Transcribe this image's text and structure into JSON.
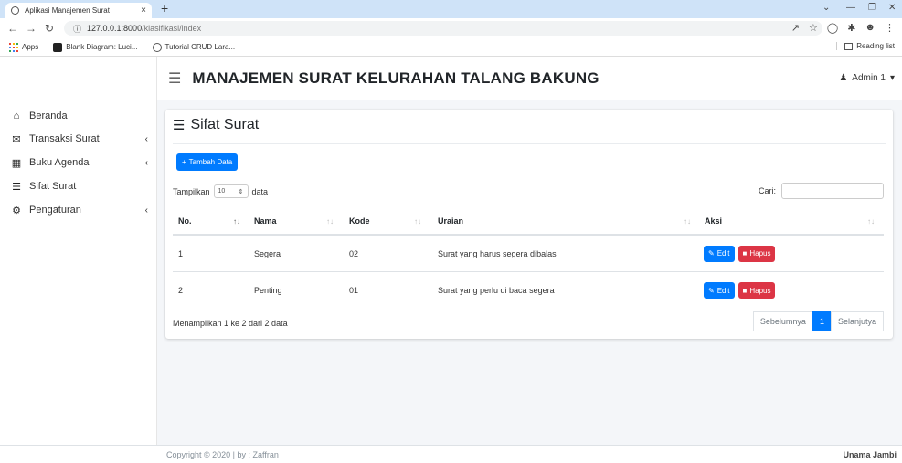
{
  "browser": {
    "tab_title": "Aplikasi Manajemen Surat",
    "tab_close": "×",
    "new_tab": "+",
    "url_host": "127.0.0.1:8000",
    "url_path": "/klasifikasi/index",
    "bookmarks": [
      "Apps",
      "Blank Diagram: Luci...",
      "Tutorial CRUD Lara..."
    ],
    "reading_list": "Reading list"
  },
  "navbar": {
    "title": "MANAJEMEN SURAT KELURAHAN TALANG BAKUNG",
    "user": "Admin 1"
  },
  "sidebar": {
    "items": [
      {
        "label": "Beranda",
        "icon": "home-icon"
      },
      {
        "label": "Transaksi Surat",
        "icon": "mail-icon"
      },
      {
        "label": "Buku Agenda",
        "icon": "book-icon"
      },
      {
        "label": "Sifat Surat",
        "icon": "layers-icon"
      },
      {
        "label": "Pengaturan",
        "icon": "cogs-icon"
      }
    ]
  },
  "page": {
    "title": "Sifat Surat",
    "add_button": "Tambah Data",
    "show_label": "Tampilkan",
    "show_value": "10",
    "show_suffix": "data",
    "search_label": "Cari:",
    "search_value": ""
  },
  "table": {
    "headers": [
      "No.",
      "Nama",
      "Kode",
      "Uraian",
      "Aksi"
    ],
    "rows": [
      {
        "no": "1",
        "nama": "Segera",
        "kode": "02",
        "uraian": "Surat yang harus segera dibalas"
      },
      {
        "no": "2",
        "nama": "Penting",
        "kode": "01",
        "uraian": "Surat yang perlu di baca segera"
      }
    ],
    "edit_label": "Edit",
    "delete_label": "Hapus"
  },
  "pagination": {
    "info": "Menampilkan 1 ke 2 dari 2 data",
    "prev": "Sebelumnya",
    "current": "1",
    "next": "Selanjutya"
  },
  "footer": {
    "copyright": "Copyright © 2020 | by : Zaffran",
    "brand": "Unama Jambi"
  }
}
